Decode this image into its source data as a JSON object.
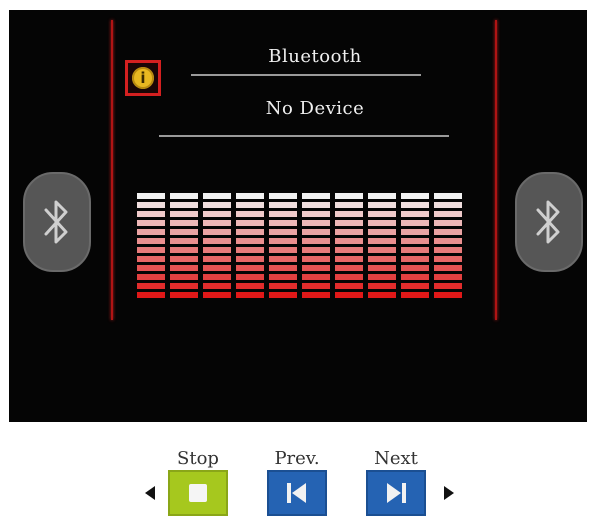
{
  "header": {
    "title": "Bluetooth"
  },
  "status": {
    "device": "No Device"
  },
  "icons": {
    "info": "info-icon",
    "bluetooth_left": "bluetooth-icon",
    "bluetooth_right": "bluetooth-icon"
  },
  "equalizer": {
    "bars": 10,
    "levels": [
      12,
      12,
      12,
      12,
      12,
      12,
      12,
      12,
      12,
      12
    ],
    "segments": 12,
    "colors": {
      "top": "#f2f2f2",
      "bottom": "#e01818"
    }
  },
  "controls": {
    "stop_label": "Stop",
    "prev_label": "Prev.",
    "next_label": "Next",
    "stop_color": "#a6c81e",
    "prev_color": "#2563b3",
    "next_color": "#2563b3"
  }
}
